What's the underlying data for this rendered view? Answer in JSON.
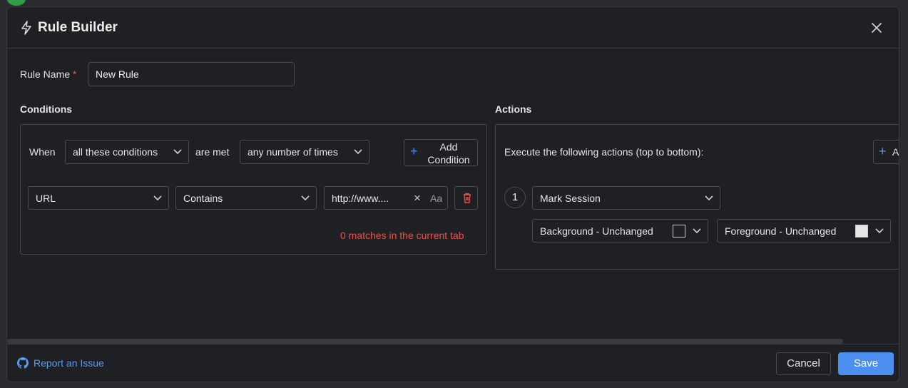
{
  "modal": {
    "title": "Rule Builder",
    "title_icon": "lightning-bolt-icon",
    "close_icon": "close-icon"
  },
  "rule_name": {
    "label": "Rule Name",
    "required_mark": "*",
    "value": "New Rule"
  },
  "conditions": {
    "title": "Conditions",
    "when_label": "When",
    "match_mode": "all these conditions",
    "are_met_label": "are met",
    "frequency": "any number of times",
    "add_button": {
      "plus": "+",
      "label": "Add Condition"
    },
    "rows": [
      {
        "field": "URL",
        "operator": "Contains",
        "value": "http://www....",
        "clear_glyph": "×",
        "case_glyph": "Aa"
      }
    ],
    "matches_text": "0 matches in the current tab"
  },
  "actions": {
    "title": "Actions",
    "description": "Execute the following actions (top to bottom):",
    "add_button": {
      "plus": "+",
      "label": "A"
    },
    "items": [
      {
        "index": "1",
        "action": "Mark Session",
        "background": {
          "label": "Background - Unchanged",
          "swatch_color": "#1f2023"
        },
        "foreground": {
          "label": "Foreground - Unchanged",
          "swatch_color": "#e6e6e6"
        }
      }
    ]
  },
  "footer": {
    "report_link": "Report an Issue",
    "report_icon": "github-icon",
    "cancel_label": "Cancel",
    "save_label": "Save"
  },
  "colors": {
    "accent": "#4c8ff0",
    "danger": "#e5534b",
    "panel_bg": "#1f2023"
  }
}
